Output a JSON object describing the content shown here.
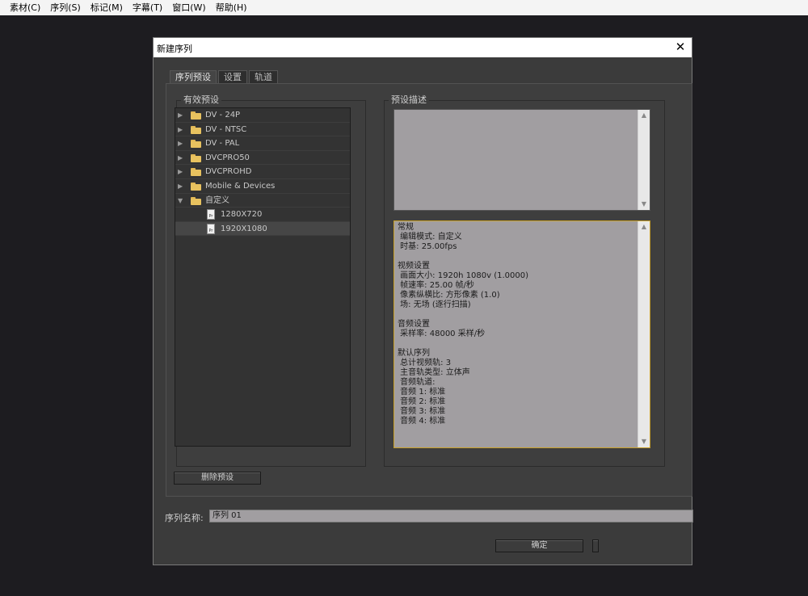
{
  "menu": [
    "素材(C)",
    "序列(S)",
    "标记(M)",
    "字幕(T)",
    "窗口(W)",
    "帮助(H)"
  ],
  "dialog": {
    "title": "新建序列",
    "close_glyph": "✕"
  },
  "tabs": [
    "序列预设",
    "设置",
    "轨道"
  ],
  "presets": {
    "legend": "有效预设",
    "items": [
      {
        "label": "DV - 24P",
        "type": "folder",
        "expanded": false
      },
      {
        "label": "DV - NTSC",
        "type": "folder",
        "expanded": false
      },
      {
        "label": "DV - PAL",
        "type": "folder",
        "expanded": false
      },
      {
        "label": "DVCPRO50",
        "type": "folder",
        "expanded": false
      },
      {
        "label": "DVCPROHD",
        "type": "folder",
        "expanded": false
      },
      {
        "label": "Mobile & Devices",
        "type": "folder",
        "expanded": false
      },
      {
        "label": "自定义",
        "type": "folder",
        "expanded": true
      },
      {
        "label": "1280X720",
        "type": "preset",
        "icon_text": "Pr"
      },
      {
        "label": "1920X1080",
        "type": "preset",
        "icon_text": "Pr",
        "selected": true
      }
    ]
  },
  "description": {
    "legend": "预设描述",
    "lines": [
      "常规",
      " 编辑模式: 自定义",
      " 时基: 25.00fps",
      "",
      "视频设置",
      " 画面大小: 1920h 1080v (1.0000)",
      " 帧速率: 25.00 帧/秒",
      " 像素纵横比: 方形像素 (1.0)",
      " 场: 无场 (逐行扫描)",
      "",
      "音频设置",
      " 采样率: 48000 采样/秒",
      "",
      "默认序列",
      " 总计视频轨: 3",
      " 主音轨类型: 立体声",
      " 音频轨道:",
      " 音频 1: 标准",
      " 音频 2: 标准",
      " 音频 3: 标准",
      " 音频 4: 标准"
    ]
  },
  "delete_button": "删除预设",
  "sequence_name": {
    "label": "序列名称:",
    "value": "序列 01"
  },
  "ok_button": "确定",
  "colors": {
    "folder": "#e8c25f",
    "selected_field_border": "#c8a028"
  }
}
